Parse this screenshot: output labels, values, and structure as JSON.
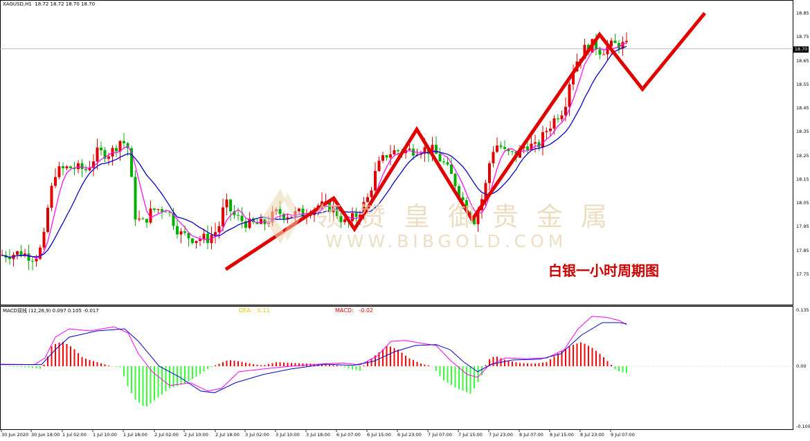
{
  "header": {
    "symbol": "XAGUSD,H1",
    "ohlc": "18.72 18.72 18.70 18.70"
  },
  "annotation": "白银一小时周期图",
  "watermark": {
    "chinese": "领赞皇御贵金属",
    "english": "WWW.BIBGOLD.COM"
  },
  "macd_panel": {
    "header": "MACD双线 (12,26,9) 0.097 0.105 -0.017",
    "dea_label": "DEA:",
    "dea_value": "0.11",
    "macd_label": "MACD:",
    "macd_value": "-0.02"
  },
  "current_price_badge": "18.70",
  "colors": {
    "bull_candle": "#e00000",
    "bear_candle": "#00b000",
    "ma_fast": "#ff00ff",
    "ma_slow": "#0000cc",
    "zigzag": "#e00000",
    "hist_up": "#ff0000",
    "hist_down": "#33ff33"
  },
  "chart_data": [
    {
      "type": "candlestick",
      "title": "XAGUSD,H1",
      "y_axis_ticks": [
        "18.85",
        "18.75",
        "18.65",
        "18.55",
        "18.45",
        "18.35",
        "18.25",
        "18.15",
        "18.05",
        "17.95",
        "17.85",
        "17.75"
      ],
      "ylim": [
        17.73,
        18.88
      ],
      "x_axis_ticks": [
        "30 Jun 2020",
        "30 Jun 18:00",
        "1 Jul 02:00",
        "1 Jul 10:00",
        "1 Jul 18:00",
        "2 Jul 02:00",
        "2 Jul 10:00",
        "2 Jul 18:00",
        "3 Jul 02:00",
        "3 Jul 10:00",
        "3 Jul 18:00",
        "6 Jul 07:00",
        "6 Jul 15:00",
        "6 Jul 23:00",
        "7 Jul 07:00",
        "7 Jul 15:00",
        "7 Jul 23:00",
        "8 Jul 07:00",
        "8 Jul 15:00",
        "8 Jul 23:00",
        "9 Jul 07:00"
      ],
      "current_price": 18.7,
      "zigzag_path": [
        {
          "bar": 0,
          "price": 17.77
        },
        {
          "bar": 1,
          "price": 18.07
        },
        {
          "bar": 2,
          "price": 17.94
        },
        {
          "bar": 3,
          "price": 18.36
        },
        {
          "bar": 4,
          "price": 17.98
        },
        {
          "bar": 5,
          "price": 18.76
        },
        {
          "bar": 6,
          "price": 18.53
        },
        {
          "bar": 7,
          "price": 18.85
        }
      ]
    },
    {
      "type": "macd",
      "title": "MACD双线 (12,26,9) 0.097 0.105 -0.017",
      "y_axis_ticks": [
        "0.135",
        "0.00",
        "-0.109"
      ],
      "ylim": [
        -0.109,
        0.135
      ]
    }
  ]
}
